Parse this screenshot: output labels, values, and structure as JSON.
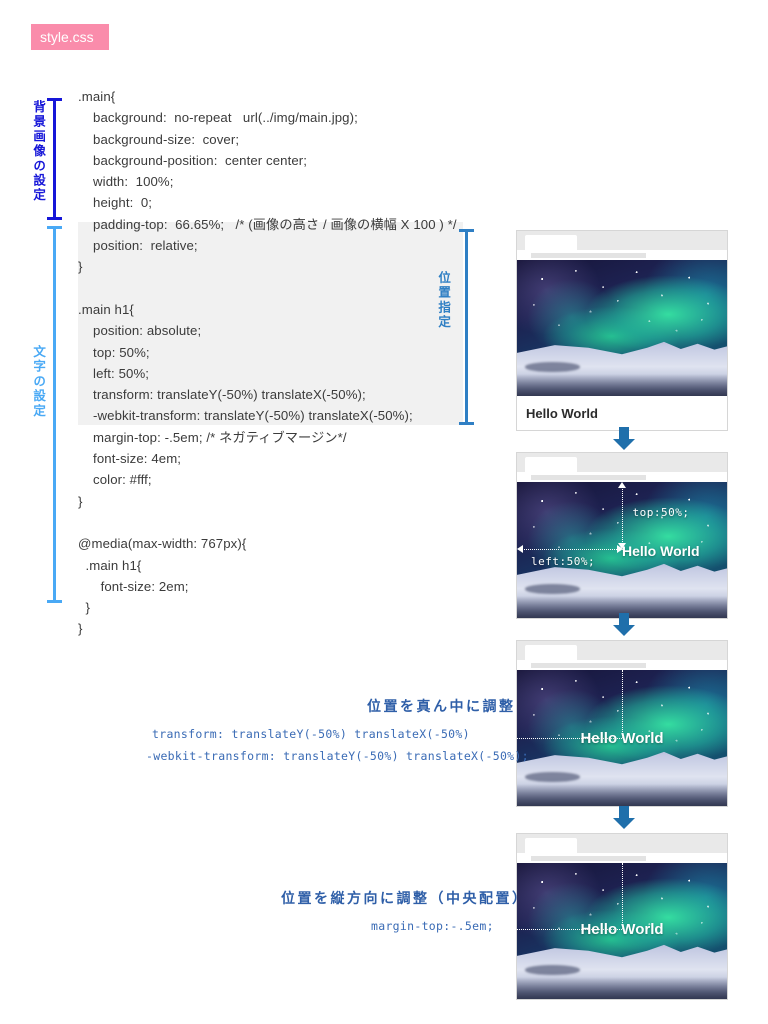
{
  "file_badge": {
    "label": "style.css"
  },
  "code": {
    "lines": [
      ".main{",
      "    background:  no-repeat   url(../img/main.jpg);",
      "    background-size:  cover;",
      "    background-position:  center center;",
      "    width:  100%;",
      "    height:  0;",
      "    padding-top:  66.65%;   /* (画像の高さ / 画像の横幅 X 100 ) */",
      "    position:  relative;",
      "}",
      "",
      ".main h1{",
      "    position: absolute;",
      "    top: 50%;",
      "    left: 50%;",
      "    transform: translateY(-50%) translateX(-50%);",
      "    -webkit-transform: translateY(-50%) translateX(-50%);",
      "    margin-top: -.5em; /* ネガティブマージン*/",
      "    font-size: 4em;",
      "    color: #fff;",
      "}",
      "",
      "@media(max-width: 767px){",
      "  .main h1{",
      "      font-size: 2em;",
      "  }",
      "}"
    ]
  },
  "brackets": {
    "background_image": {
      "label": "背景画像の設定",
      "color": "#1616d8"
    },
    "text_settings": {
      "label": "文字の設定",
      "color": "#49a9f5"
    },
    "position_spec": {
      "label": "位置指定",
      "color": "#2f7fc4"
    }
  },
  "mockups": [
    {
      "name": "step-1",
      "caption": "Hello World",
      "overlay": null,
      "annotations": []
    },
    {
      "name": "step-2",
      "caption": null,
      "overlay": "Hello World",
      "annotations": [
        {
          "label": "top:50%;"
        },
        {
          "label": "left:50%;"
        }
      ]
    },
    {
      "name": "step-3",
      "caption": null,
      "overlay": "Hello World",
      "annotations": []
    },
    {
      "name": "step-4",
      "caption": null,
      "overlay": "Hello World",
      "annotations": []
    }
  ],
  "notes": [
    {
      "heading": "位置を真ん中に調整",
      "code": [
        "transform: translateY(-50%) translateX(-50%)",
        "-webkit-transform: translateY(-50%) translateX(-50%);"
      ]
    },
    {
      "heading": "位置を縦方向に調整（中央配置）",
      "code": [
        "margin-top:-.5em;"
      ]
    }
  ],
  "colors": {
    "badge_pink": "#fa8cab",
    "arrow_blue": "#1f6fab",
    "note_blue": "#2f5fa8",
    "code_bg": "#f1f1f1"
  }
}
